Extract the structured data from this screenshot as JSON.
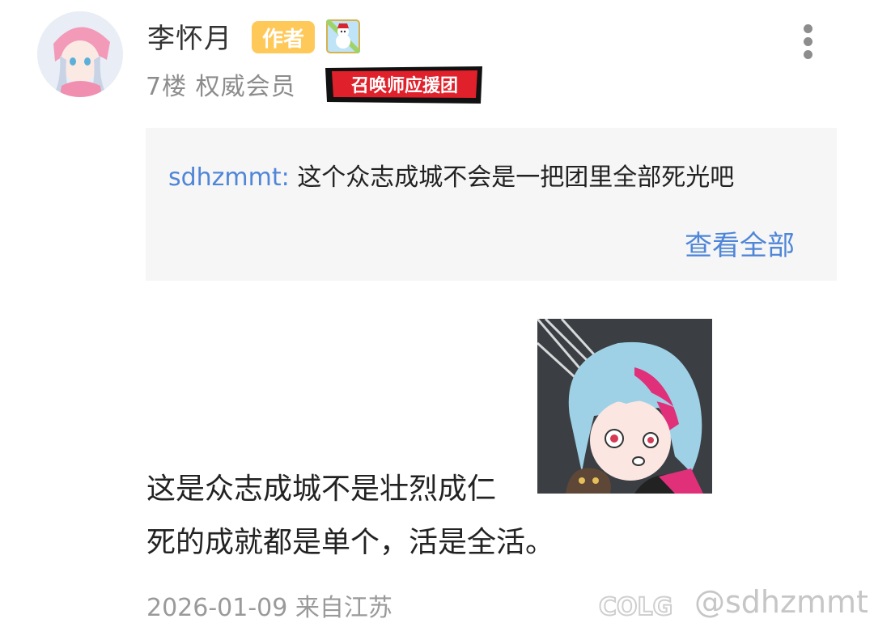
{
  "post": {
    "username": "李怀月",
    "author_badge": "作者",
    "floor": "7楼",
    "member_level": "权威会员",
    "fan_badge": "召唤师应援团",
    "level_icon": "snowman-badge-icon",
    "more_icon": "more-vertical-icon",
    "date": "2026-01-09",
    "location": "来自江苏"
  },
  "quote": {
    "user": "sdhzmmt:",
    "text": "这个众志成城不会是一把团里全部死光吧",
    "view_all": "查看全部"
  },
  "content": {
    "line1": "这是众志成城不是壮烈成仁",
    "line2": "死的成就都是单个，活是全活。",
    "sticker": "anime-character-sticker"
  },
  "watermark": {
    "text": "@sdhzmmt",
    "logo": "colg-logo"
  },
  "colors": {
    "link_blue": "#4f86d8",
    "author_badge_bg": "#ffc95a",
    "fan_badge_red": "#e0202a",
    "quote_bg": "#f6f6f6"
  }
}
